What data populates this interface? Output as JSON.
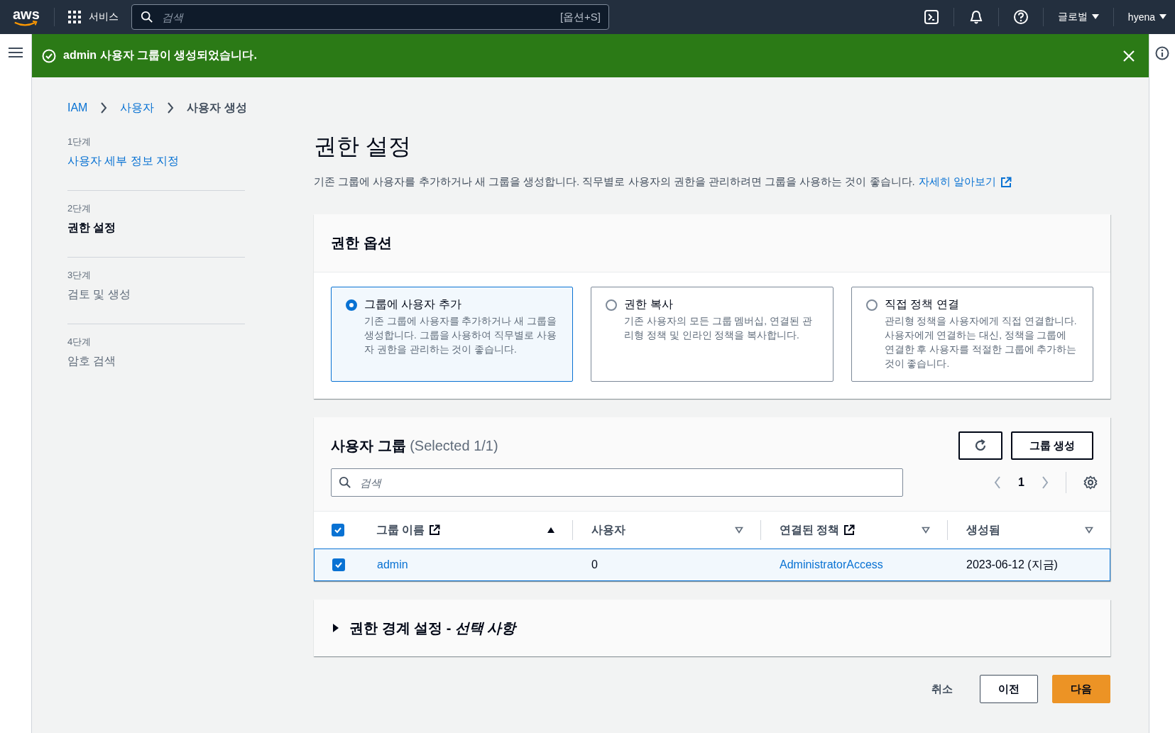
{
  "top_nav": {
    "logo": "aws",
    "services": "서비스",
    "search": {
      "placeholder": "검색",
      "shortcut": "[옵션+S]"
    },
    "region": "글로벌",
    "user": "hyena"
  },
  "flash": {
    "message": "admin 사용자 그룹이 생성되었습니다."
  },
  "breadcrumbs": [
    {
      "label": "IAM",
      "link": true
    },
    {
      "label": "사용자",
      "link": true
    },
    {
      "label": "사용자 생성",
      "link": false
    }
  ],
  "steps": [
    {
      "step": "1단계",
      "title": "사용자 세부 정보 지정",
      "selected": false,
      "link": true
    },
    {
      "step": "2단계",
      "title": "권한 설정",
      "selected": true,
      "link": false
    },
    {
      "step": "3단계",
      "title": "검토 및 생성",
      "selected": false,
      "link": false
    },
    {
      "step": "4단계",
      "title": "암호 검색",
      "selected": false,
      "link": false
    }
  ],
  "page": {
    "title": "권한 설정",
    "description": "기존 그룹에 사용자를 추가하거나 새 그룹을 생성합니다. 직무별로 사용자의 권한을 관리하려면 그룹을 사용하는 것이 좋습니다.",
    "learn_more": "자세히 알아보기"
  },
  "permission_options": {
    "title": "권한 옵션",
    "options": [
      {
        "label": "그룹에 사용자 추가",
        "description": "기존 그룹에 사용자를 추가하거나 새 그룹을 생성합니다. 그룹을 사용하여 직무별로 사용자 권한을 관리하는 것이 좋습니다.",
        "selected": true
      },
      {
        "label": "권한 복사",
        "description": "기존 사용자의 모든 그룹 멤버십, 연결된 관리형 정책 및 인라인 정책을 복사합니다.",
        "selected": false
      },
      {
        "label": "직접 정책 연결",
        "description": "관리형 정책을 사용자에게 직접 연결합니다. 사용자에게 연결하는 대신, 정책을 그룹에 연결한 후 사용자를 적절한 그룹에 추가하는 것이 좋습니다.",
        "selected": false
      }
    ]
  },
  "user_groups": {
    "title": "사용자 그룹",
    "count": "(Selected 1/1)",
    "create_button": "그룹 생성",
    "search": {
      "placeholder": "검색"
    },
    "page": "1",
    "all_selected": true,
    "columns": [
      {
        "label": "그룹 이름",
        "external_link": true,
        "sorted": true
      },
      {
        "label": "사용자",
        "external_link": false,
        "sorted": false
      },
      {
        "label": "연결된 정책",
        "external_link": true,
        "sorted": false
      },
      {
        "label": "생성됨",
        "external_link": false,
        "sorted": false
      }
    ],
    "rows": [
      {
        "selected": true,
        "cells": [
          "admin",
          "0",
          "AdministratorAccess",
          "2023-06-12 (지금)"
        ]
      }
    ]
  },
  "boundary": {
    "title": "권한 경계 설정 - *선택 사항*",
    "expanded": false
  },
  "actions": {
    "cancel": "취소",
    "previous": "이전",
    "next": "다음"
  }
}
